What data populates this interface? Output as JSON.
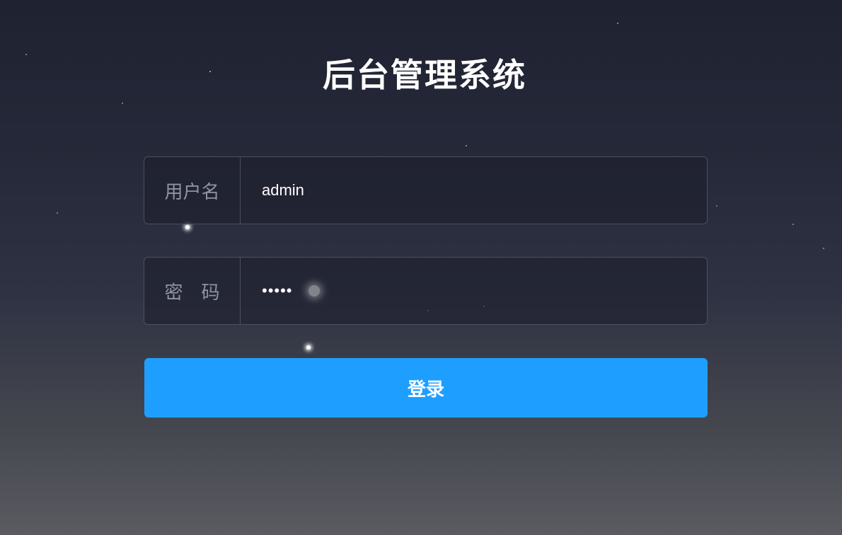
{
  "page": {
    "title": "后台管理系统"
  },
  "form": {
    "username": {
      "label": "用户名",
      "value": "admin"
    },
    "password": {
      "label": "密　码",
      "masked_value": "•••••"
    },
    "submit_label": "登录"
  },
  "colors": {
    "button_bg": "#1e9fff",
    "background_top": "#1f2231",
    "background_bottom": "#5a5b61"
  }
}
